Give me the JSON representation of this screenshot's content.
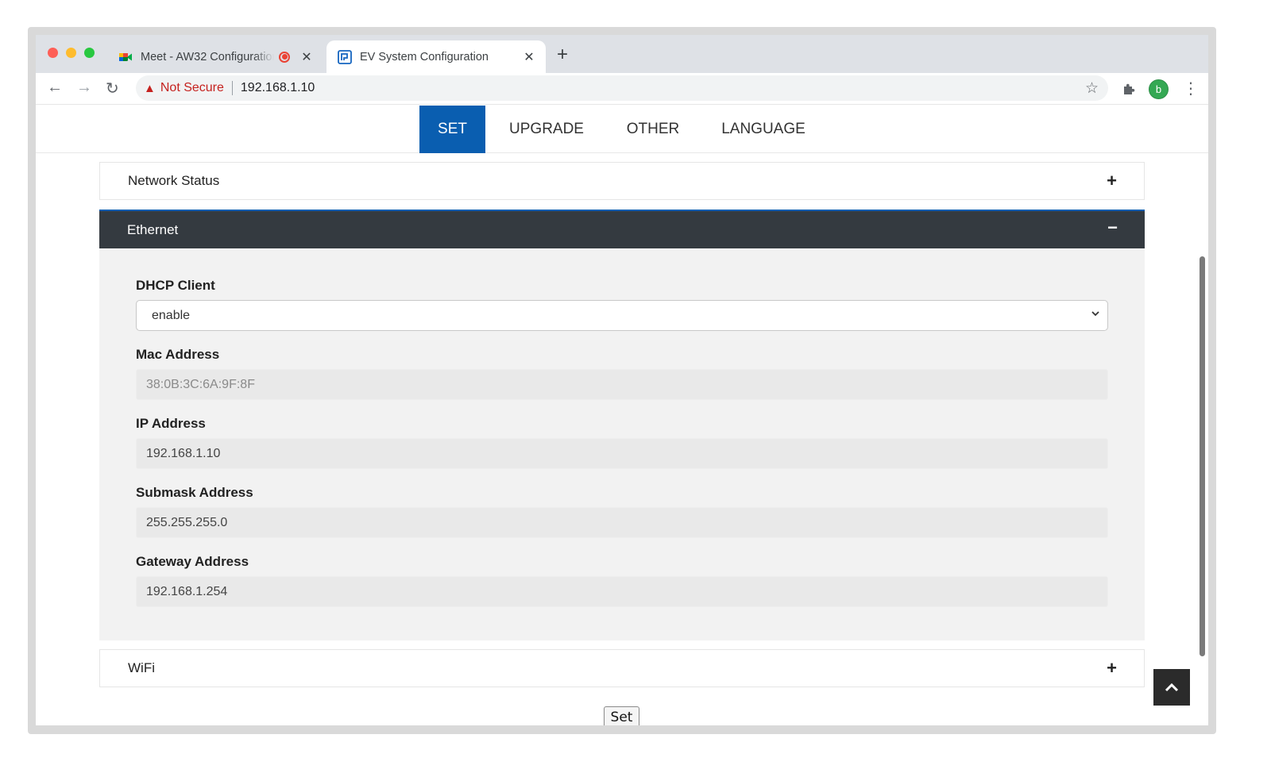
{
  "browser": {
    "tabs": [
      {
        "title": "Meet - AW32 Configuration",
        "icon": "google-meet-icon",
        "recording": true
      },
      {
        "title": "EV System Configuration",
        "icon": "site-favicon",
        "active": true
      }
    ],
    "new_tab_label": "+",
    "security_label": "Not Secure",
    "url": "192.168.1.10",
    "profile_initial": "b"
  },
  "nav": {
    "items": [
      {
        "label": "SET",
        "active": true
      },
      {
        "label": "UPGRADE"
      },
      {
        "label": "OTHER"
      },
      {
        "label": "LANGUAGE"
      }
    ]
  },
  "sections": {
    "network_status": {
      "title": "Network Status",
      "toggle": "+"
    },
    "ethernet": {
      "title": "Ethernet",
      "toggle": "−",
      "fields": {
        "dhcp_label": "DHCP Client",
        "dhcp_value": "enable",
        "mac_label": "Mac Address",
        "mac_value": "38:0B:3C:6A:9F:8F",
        "ip_label": "IP Address",
        "ip_value": "192.168.1.10",
        "submask_label": "Submask Address",
        "submask_value": "255.255.255.0",
        "gateway_label": "Gateway Address",
        "gateway_value": "192.168.1.254"
      }
    },
    "wifi": {
      "title": "WiFi",
      "toggle": "+"
    }
  },
  "actions": {
    "set_label": "Set"
  },
  "colors": {
    "accent": "#0a5eb0",
    "panel_dark": "#343a40",
    "warning": "#c5221f"
  }
}
